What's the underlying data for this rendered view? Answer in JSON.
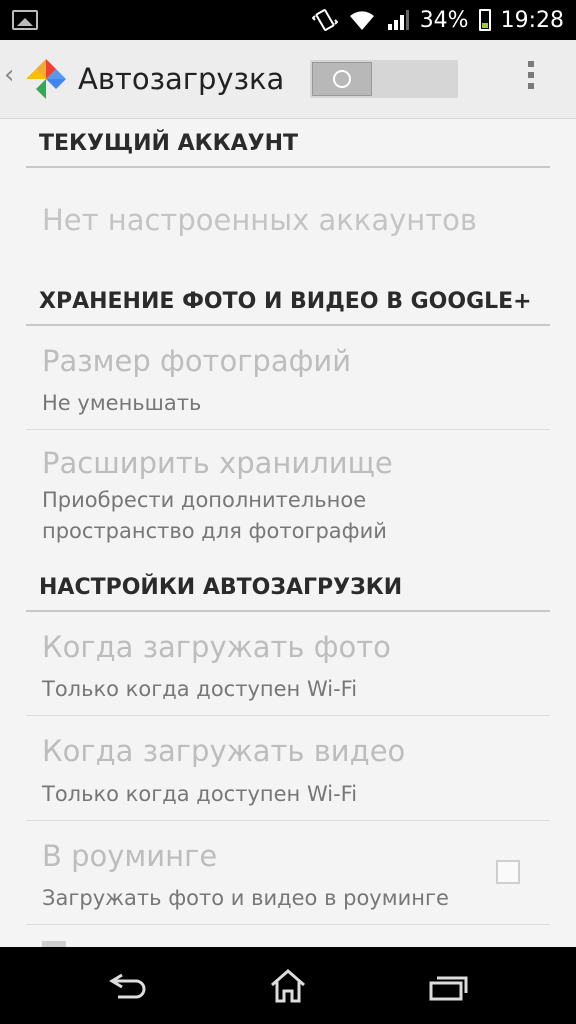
{
  "status_bar": {
    "battery_percent": "34%",
    "time": "19:28",
    "battery_level": 0.34,
    "icons": [
      "gallery-icon",
      "vibrate-icon",
      "wifi-icon",
      "signal-icon",
      "battery-icon"
    ]
  },
  "action_bar": {
    "title": "Автозагрузка",
    "toggle_on": false,
    "icons": [
      "up-caret-icon",
      "photos-pinwheel-icon",
      "overflow-menu-icon"
    ]
  },
  "sections": {
    "account": {
      "header": "ТЕКУЩИЙ АККАУНТ",
      "no_accounts": "Нет настроенных аккаунтов"
    },
    "storage": {
      "header": "ХРАНЕНИЕ ФОТО И ВИДЕО В GOOGLE+",
      "photo_size_title": "Размер фотографий",
      "photo_size_summary": "Не уменьшать",
      "expand_title": "Расширить хранилище",
      "expand_summary": "Приобрести дополнительное пространство для фотографий"
    },
    "autoupload": {
      "header": "НАСТРОЙКИ АВТОЗАГРУЗКИ",
      "photo_when_title": "Когда загружать фото",
      "photo_when_summary": "Только когда доступен Wi-Fi",
      "video_when_title": "Когда загружать видео",
      "video_when_summary": "Только когда доступен Wi-Fi",
      "roaming_title": "В роуминге",
      "roaming_summary": "Загружать фото и видео в роуминге",
      "roaming_checked": false
    }
  },
  "nav_bar": {
    "icons": [
      "back-icon",
      "home-icon",
      "recent-apps-icon"
    ]
  },
  "colors": {
    "accent_green": "#9ccb3a",
    "disabled_text": "#bdbdbd",
    "header_text": "#2b2b2b"
  }
}
